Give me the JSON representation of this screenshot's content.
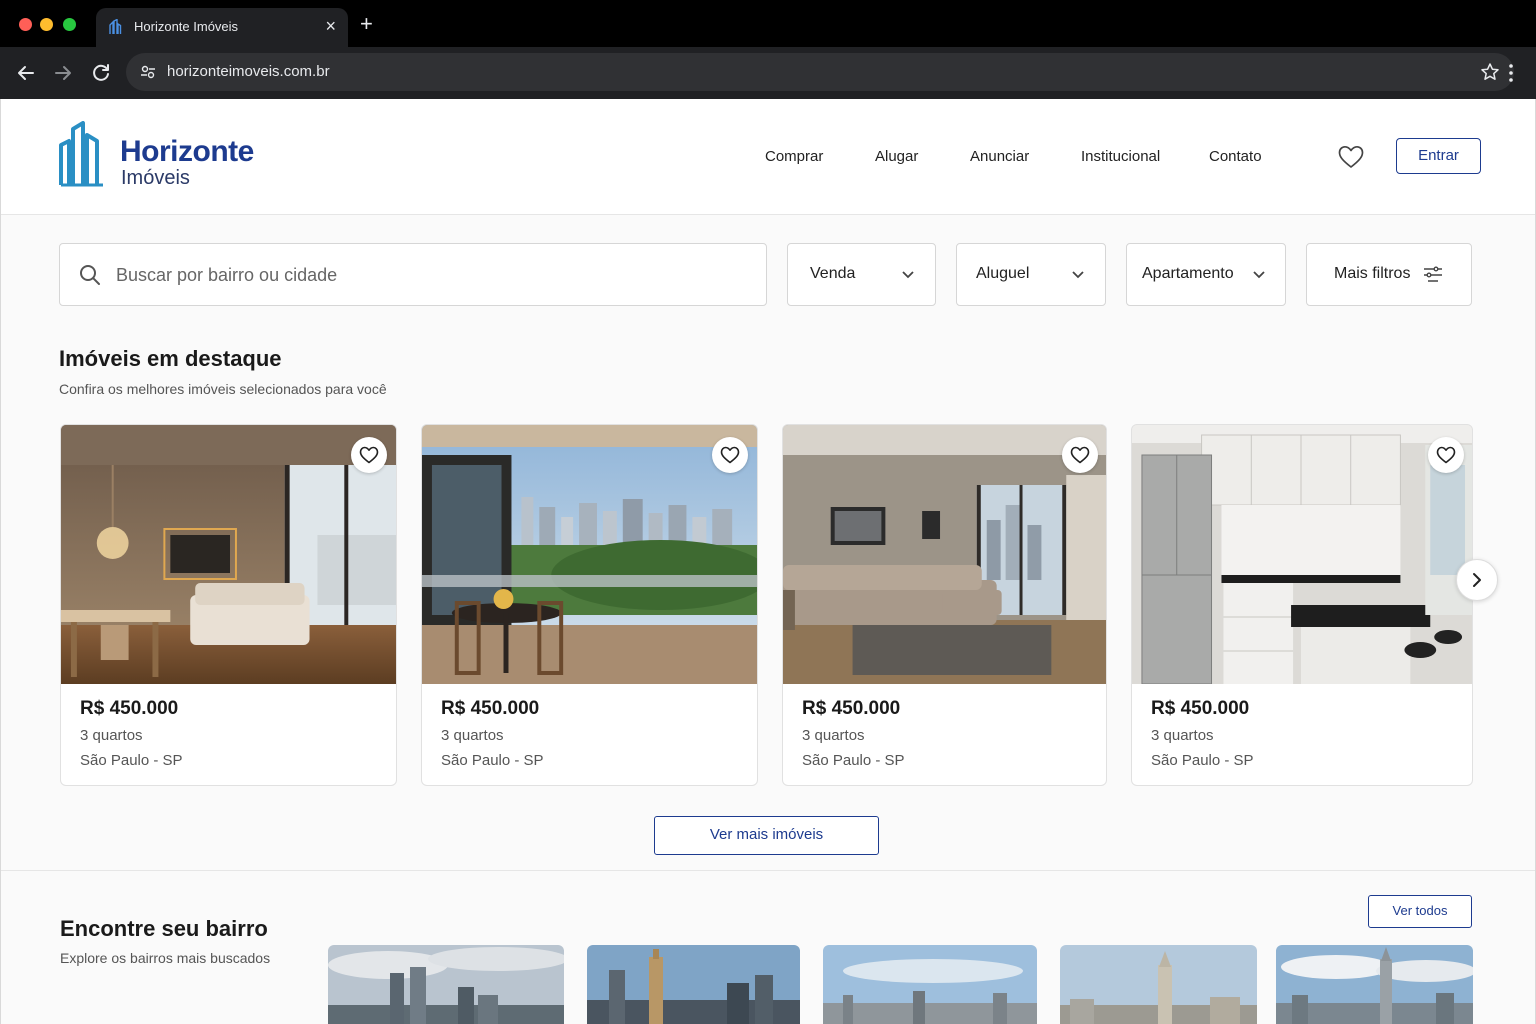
{
  "browser": {
    "tab_title": "Horizonte Imóveis",
    "url": "horizonteimoveis.com.br"
  },
  "brand": {
    "name": "Horizonte",
    "tagline": "Imóveis",
    "color": "#1d3b8f"
  },
  "nav": {
    "items": [
      "Comprar",
      "Alugar",
      "Anunciar",
      "Institucional",
      "Contato"
    ],
    "login_label": "Entrar"
  },
  "search": {
    "placeholder": "Buscar por bairro ou cidade",
    "filters": [
      "Venda",
      "Aluguel",
      "Apartamento"
    ],
    "more_filters_label": "Mais filtros"
  },
  "featured": {
    "title": "Imóveis em destaque",
    "subtitle": "Confira os melhores imóveis selecionados para você",
    "listings": [
      {
        "price": "R$ 450.000",
        "rooms": "3 quartos",
        "location": "São Paulo - SP",
        "photo": "living room with balcony"
      },
      {
        "price": "R$ 450.000",
        "rooms": "3 quartos",
        "location": "São Paulo - SP",
        "photo": "glass balcony with city view"
      },
      {
        "price": "R$ 450.000",
        "rooms": "3 quartos",
        "location": "São Paulo - SP",
        "photo": "living room with sofa"
      },
      {
        "price": "R$ 450.000",
        "rooms": "3 quartos",
        "location": "São Paulo - SP",
        "photo": "modern kitchen"
      }
    ],
    "more_label": "Ver mais imóveis"
  },
  "neighborhoods": {
    "title": "Encontre seu bairro",
    "subtitle": "Explore os bairros mais buscados",
    "see_all_label": "Ver todos"
  }
}
